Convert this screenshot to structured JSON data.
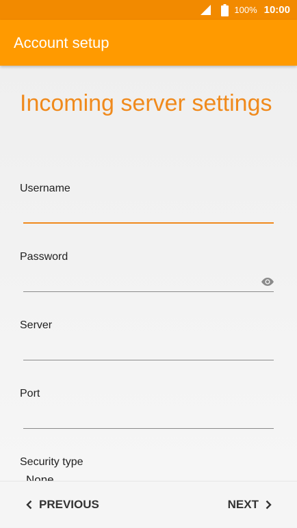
{
  "status_bar": {
    "battery_text": "100%",
    "time": "10:00",
    "icons": [
      "signal-icon",
      "battery-icon"
    ]
  },
  "app_bar": {
    "title": "Account setup"
  },
  "form": {
    "title": "Incoming server settings",
    "fields": [
      {
        "label": "Username",
        "value": "",
        "active": true
      },
      {
        "label": "Password",
        "value": "",
        "icon": "eye-icon"
      },
      {
        "label": "Server",
        "value": ""
      },
      {
        "label": "Port",
        "value": ""
      },
      {
        "label": "Security type",
        "value": "None",
        "icon": "dropdown-arrow-icon"
      }
    ]
  },
  "bottom_bar": {
    "previous_label": "PREVIOUS",
    "next_label": "NEXT"
  },
  "colors": {
    "status_bar": "#f28a00",
    "app_bar": "#ff9a00",
    "accent": "#f0891b"
  }
}
